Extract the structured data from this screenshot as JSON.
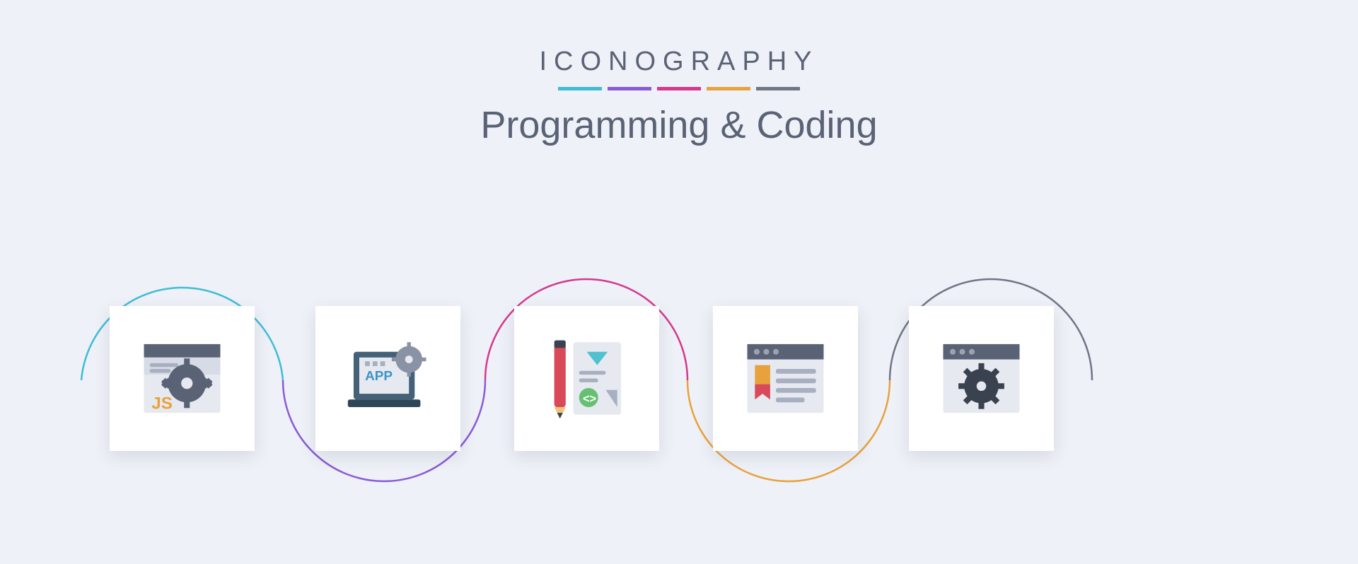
{
  "brand": "ICONOGRAPHY",
  "title": "Programming & Coding",
  "underlines": [
    "#3fbcd6",
    "#8a5bd6",
    "#d6378f",
    "#e8a23d",
    "#6f7685"
  ],
  "icons": [
    {
      "name": "js-settings-icon"
    },
    {
      "name": "app-develop-icon"
    },
    {
      "name": "design-document-icon"
    },
    {
      "name": "web-certificate-icon"
    },
    {
      "name": "browser-gear-icon"
    }
  ],
  "curves": [
    {
      "color": "#3fbcd6"
    },
    {
      "color": "#8a5bd6"
    },
    {
      "color": "#d6378f"
    },
    {
      "color": "#e8a23d"
    },
    {
      "color": "#6f7685"
    }
  ]
}
